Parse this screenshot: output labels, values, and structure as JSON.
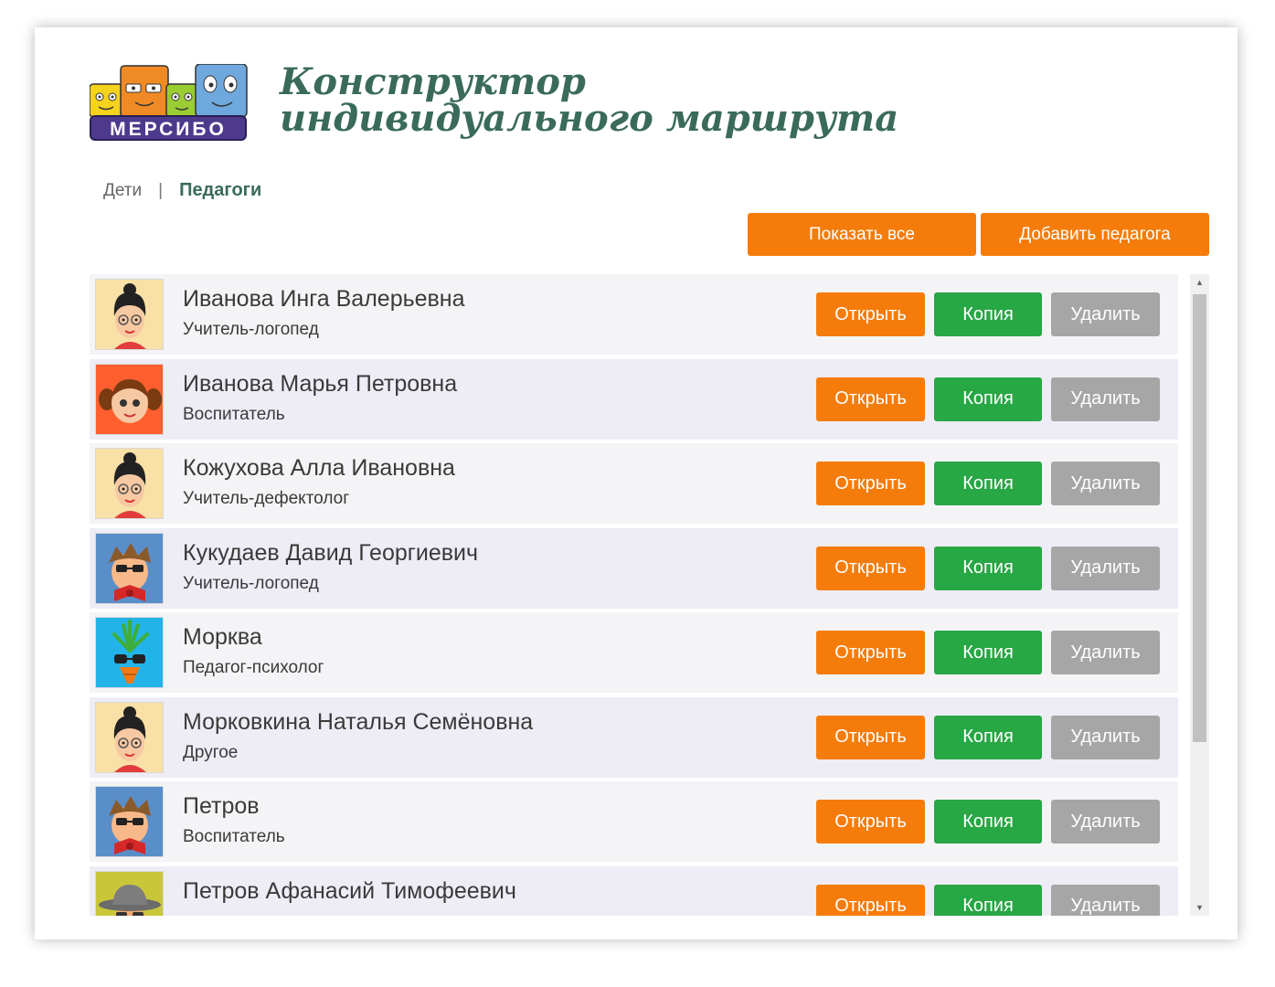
{
  "app": {
    "logo_text": "МЕРСИБО",
    "title": "Конструктор индивидуального маршрута"
  },
  "nav": {
    "children": "Дети",
    "separator": "|",
    "teachers": "Педагоги"
  },
  "toolbar": {
    "show_all": "Показать все",
    "add_teacher": "Добавить педагога"
  },
  "actions": {
    "open": "Открыть",
    "copy": "Копия",
    "delete": "Удалить"
  },
  "teachers": [
    {
      "name": "Иванова Инга Валерьевна",
      "role": "Учитель-логопед",
      "avatar": "woman-glasses-icon"
    },
    {
      "name": "Иванова Марья Петровна",
      "role": "Воспитатель",
      "avatar": "girl-pigtails-icon"
    },
    {
      "name": "Кожухова Алла Ивановна",
      "role": "Учитель-дефектолог",
      "avatar": "woman-glasses-icon"
    },
    {
      "name": "Кукудаев Давид Георгиевич",
      "role": "Учитель-логопед",
      "avatar": "man-bowtie-icon"
    },
    {
      "name": "Морква",
      "role": "Педагог-психолог",
      "avatar": "carrot-icon"
    },
    {
      "name": "Морковкина Наталья Семёновна",
      "role": "Другое",
      "avatar": "woman-glasses-icon"
    },
    {
      "name": "Петров",
      "role": "Воспитатель",
      "avatar": "man-bowtie-icon"
    },
    {
      "name": "Петров Афанасий Тимофеевич",
      "role": "",
      "avatar": "man-hat-icon"
    }
  ],
  "colors": {
    "accent_orange": "#f57c0b",
    "copy_green": "#28a745",
    "delete_gray": "#a6a6a6",
    "title_green": "#3a6b58"
  }
}
